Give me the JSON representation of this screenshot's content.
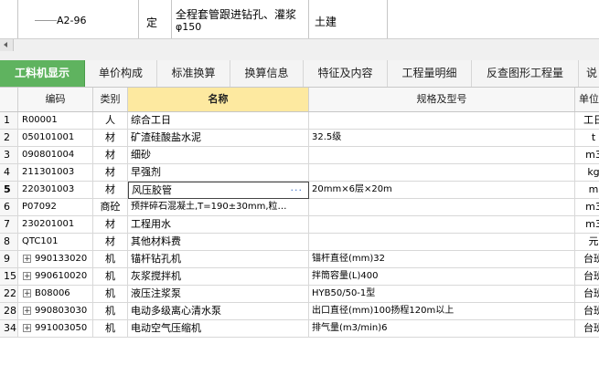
{
  "top_row": {
    "code": "A2-96",
    "type": "定",
    "name_line1": "全程套管跟进钻孔、灌浆",
    "name_line2": "φ150",
    "spec": "土建"
  },
  "tabs": [
    {
      "label": "工料机显示",
      "active": true
    },
    {
      "label": "单价构成"
    },
    {
      "label": "标准换算"
    },
    {
      "label": "换算信息"
    },
    {
      "label": "特征及内容"
    },
    {
      "label": "工程量明细"
    },
    {
      "label": "反查图形工程量"
    },
    {
      "label": "说"
    }
  ],
  "table": {
    "headers": {
      "code": "编码",
      "type": "类别",
      "name": "名称",
      "spec": "规格及型号",
      "unit": "单位"
    },
    "rows": [
      {
        "idx": "1",
        "code": "R00001",
        "type": "人",
        "name": "综合工日",
        "spec": "",
        "unit": "工日"
      },
      {
        "idx": "2",
        "code": "050101001",
        "type": "材",
        "name": "矿渣硅酸盐水泥",
        "spec": "32.5级",
        "unit": "t"
      },
      {
        "idx": "3",
        "code": "090801004",
        "type": "材",
        "name": "细砂",
        "spec": "",
        "unit": "m3"
      },
      {
        "idx": "4",
        "code": "211301003",
        "type": "材",
        "name": "早强剂",
        "spec": "",
        "unit": "kg"
      },
      {
        "idx": "5",
        "code": "220301003",
        "type": "材",
        "name": "风压胶管",
        "spec": "20mm×6层×20m",
        "unit": "m",
        "current": true,
        "selected_name": true
      },
      {
        "idx": "6",
        "code": "P07092",
        "type": "商砼",
        "name": "预拌碎石混凝土,T=190±30mm,粒…",
        "spec": "",
        "unit": "m3"
      },
      {
        "idx": "7",
        "code": "230201001",
        "type": "材",
        "name": "工程用水",
        "spec": "",
        "unit": "m3"
      },
      {
        "idx": "8",
        "code": "QTC101",
        "type": "材",
        "name": "其他材料费",
        "spec": "",
        "unit": "元"
      },
      {
        "idx": "9",
        "code": "990133020",
        "type": "机",
        "name": "锚杆钻孔机",
        "spec": "锚杆直径(mm)32",
        "unit": "台班",
        "expand": true
      },
      {
        "idx": "15",
        "code": "990610020",
        "type": "机",
        "name": "灰浆搅拌机",
        "spec": "拌筒容量(L)400",
        "unit": "台班",
        "expand": true
      },
      {
        "idx": "22",
        "code": "B08006",
        "type": "机",
        "name": "液压注浆泵",
        "spec": "HYB50/50-1型",
        "unit": "台班",
        "expand": true
      },
      {
        "idx": "28",
        "code": "990803030",
        "type": "机",
        "name": "电动多级离心清水泵",
        "spec": "出口直径(mm)100扬程120m以上",
        "unit": "台班",
        "expand": true
      },
      {
        "idx": "34",
        "code": "991003050",
        "type": "机",
        "name": "电动空气压缩机",
        "spec": "排气量(m3/min)6",
        "unit": "台班",
        "expand": true
      }
    ]
  },
  "icons": {
    "expander": "plus-expander-icon",
    "ellipsis": "ellipsis-icon",
    "scroll_left": "scroll-left-arrow-icon"
  },
  "colors": {
    "active_tab": "#5fb35f",
    "selected_header": "#fde9a0",
    "ellipsis": "#3a6ec9"
  }
}
